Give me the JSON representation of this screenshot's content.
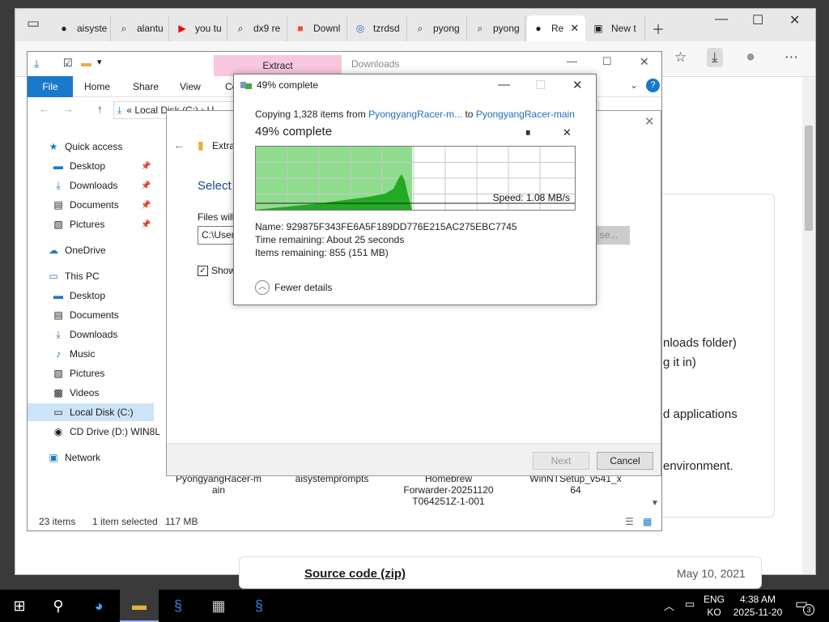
{
  "browser": {
    "tabs": [
      {
        "label": "aisyste",
        "icon": "github-icon"
      },
      {
        "label": "alantu",
        "icon": "search-icon"
      },
      {
        "label": "you tu",
        "icon": "youtube-icon"
      },
      {
        "label": "dx9 re",
        "icon": "search-icon"
      },
      {
        "label": "Downl",
        "icon": "windows-icon"
      },
      {
        "label": "tzrdsd",
        "icon": "swirl-icon"
      },
      {
        "label": "pyong",
        "icon": "search-icon"
      },
      {
        "label": "pyong",
        "icon": "search-icon"
      },
      {
        "label": "Re",
        "icon": "github-icon",
        "active": true
      },
      {
        "label": "New t",
        "icon": "newtab-icon"
      }
    ],
    "page_text": {
      "line1": "nloads folder)",
      "line2": "g it in)",
      "line3": "d applications",
      "line4": "environment.",
      "release_link": "Source code (zip)",
      "release_date": "May 10, 2021"
    }
  },
  "explorer": {
    "ribbon": {
      "file": "File",
      "home": "Home",
      "share": "Share",
      "view": "View",
      "compress": "Co",
      "extract": "Extract",
      "downloads_title": "Downloads"
    },
    "address": "«  Local Disk (C:)  ›  U",
    "nav": {
      "quick_access": "Quick access",
      "qa_desktop": "Desktop",
      "qa_downloads": "Downloads",
      "qa_documents": "Documents",
      "qa_pictures": "Pictures",
      "onedrive": "OneDrive",
      "this_pc": "This PC",
      "pc_desktop": "Desktop",
      "pc_documents": "Documents",
      "pc_downloads": "Downloads",
      "pc_music": "Music",
      "pc_pictures": "Pictures",
      "pc_videos": "Videos",
      "local_disk": "Local Disk (C:)",
      "cd_drive": "CD Drive (D:) WIN8L",
      "network": "Network"
    },
    "files_bottom": {
      "f1a": "PyongyangRacer-m",
      "f1b": "ain",
      "f2": "aisystemprompts",
      "f3a": "Homebrew",
      "f3b": "Forwarder-20251120",
      "f3c": "T064251Z-1-001",
      "f4a": "WinNTSetup_v541_x",
      "f4b": "64"
    },
    "status": {
      "items": "23 items",
      "selected": "1 item selected",
      "size": "117 MB"
    }
  },
  "wizard": {
    "heading": "Select",
    "back_title": "Extra",
    "files_label": "Files will",
    "path": "C:\\User",
    "browse": "se...",
    "show_label": "Show",
    "next": "Next",
    "cancel": "Cancel"
  },
  "progress": {
    "title": "49% complete",
    "copy_prefix": "Copying 1,328 items from ",
    "copy_from": "PyongyangRacer-m...",
    "copy_mid": " to ",
    "copy_to": "PyongyangRacer-main",
    "headline": "49% complete",
    "percent": 49,
    "speed": "Speed: 1.08 MB/s",
    "name_line": "Name:  929875F343FE6A5F189DD776E215AC275EBC7745",
    "time_line": "Time remaining:  About 25 seconds",
    "items_line": "Items remaining:  855 (151 MB)",
    "fewer_details": "Fewer details"
  },
  "taskbar": {
    "lang1": "ENG",
    "lang2": "KO",
    "time": "4:38 AM",
    "date": "2025-11-20",
    "notif_count": "3"
  }
}
